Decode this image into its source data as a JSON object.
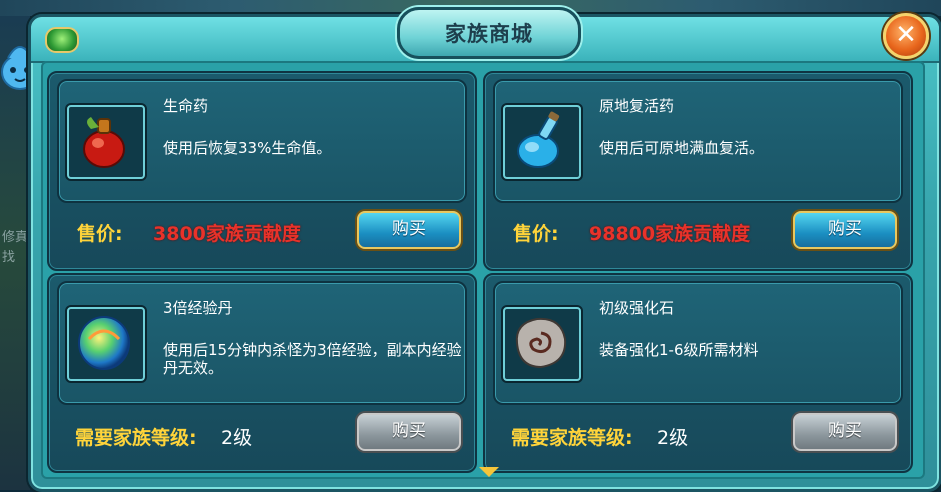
{
  "window": {
    "title": "家族商城"
  },
  "background_text": {
    "a": "修真",
    "b": "找"
  },
  "items": [
    {
      "name": "生命药",
      "description": "使用后恢复33%生命值。",
      "price_label": "售价:",
      "price": "3800家族贡献度",
      "buy_label": "购买",
      "icon": "red-potion-icon",
      "enabled": true
    },
    {
      "name": "原地复活药",
      "description": "使用后可原地满血复活。",
      "price_label": "售价:",
      "price": "98800家族贡献度",
      "buy_label": "购买",
      "icon": "blue-potion-icon",
      "enabled": true
    },
    {
      "name": "3倍经验丹",
      "description": "使用后15分钟内杀怪为3倍经验，副本内经验丹无效。",
      "requirement_label": "需要家族等级:",
      "requirement": "2级",
      "buy_label": "购买",
      "icon": "exp-orb-icon",
      "enabled": false
    },
    {
      "name": "初级强化石",
      "description": "装备强化1-6级所需材料",
      "requirement_label": "需要家族等级:",
      "requirement": "2级",
      "buy_label": "购买",
      "icon": "stone-icon",
      "enabled": false
    }
  ],
  "colors": {
    "accent": "#3bb3bb",
    "price": "#e8322a",
    "label": "#ffd43a",
    "button": "#1b8fc2",
    "button_disabled": "#8b969c"
  }
}
